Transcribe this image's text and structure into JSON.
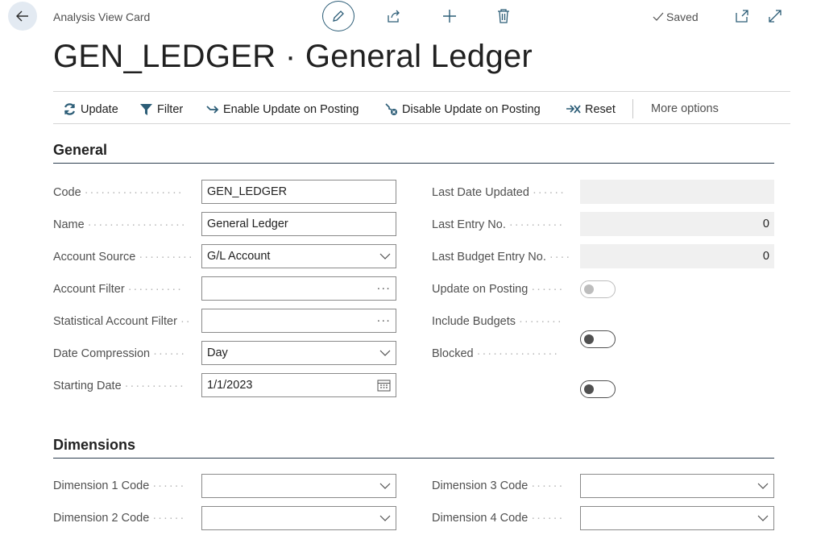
{
  "header": {
    "breadcrumb": "Analysis View Card",
    "title": "GEN_LEDGER · General Ledger",
    "saved_label": "Saved"
  },
  "actions": {
    "update": "Update",
    "filter": "Filter",
    "enable_update": "Enable Update on Posting",
    "disable_update": "Disable Update on Posting",
    "reset": "Reset",
    "more": "More options"
  },
  "general": {
    "title": "General",
    "code": {
      "label": "Code",
      "value": "GEN_LEDGER"
    },
    "name": {
      "label": "Name",
      "value": "General Ledger"
    },
    "account_source": {
      "label": "Account Source",
      "value": "G/L Account"
    },
    "account_filter": {
      "label": "Account Filter",
      "value": ""
    },
    "stat_account_filter": {
      "label": "Statistical Account Filter",
      "value": ""
    },
    "date_compression": {
      "label": "Date Compression",
      "value": "Day"
    },
    "starting_date": {
      "label": "Starting Date",
      "value": "1/1/2023"
    },
    "last_date_updated": {
      "label": "Last Date Updated",
      "value": ""
    },
    "last_entry_no": {
      "label": "Last Entry No.",
      "value": "0"
    },
    "last_budget_entry_no": {
      "label": "Last Budget Entry No.",
      "value": "0"
    },
    "update_on_posting": {
      "label": "Update on Posting",
      "value": "off",
      "disabled": true
    },
    "include_budgets": {
      "label": "Include Budgets",
      "value": "off"
    },
    "blocked": {
      "label": "Blocked",
      "value": "off"
    }
  },
  "dimensions": {
    "title": "Dimensions",
    "dim1": {
      "label": "Dimension 1 Code",
      "value": ""
    },
    "dim2": {
      "label": "Dimension 2 Code",
      "value": ""
    },
    "dim3": {
      "label": "Dimension 3 Code",
      "value": ""
    },
    "dim4": {
      "label": "Dimension 4 Code",
      "value": ""
    }
  },
  "icons": {
    "back": "arrow-left-icon",
    "edit": "pencil-icon",
    "share": "share-icon",
    "new": "plus-icon",
    "delete": "trash-icon",
    "saved": "check-icon",
    "open_new": "open-in-new-window-icon",
    "expand": "expand-icon"
  },
  "colors": {
    "accent": "#2c5d77",
    "section_rule": "#2d3e50",
    "readonly_bg": "#f0f0f0"
  }
}
